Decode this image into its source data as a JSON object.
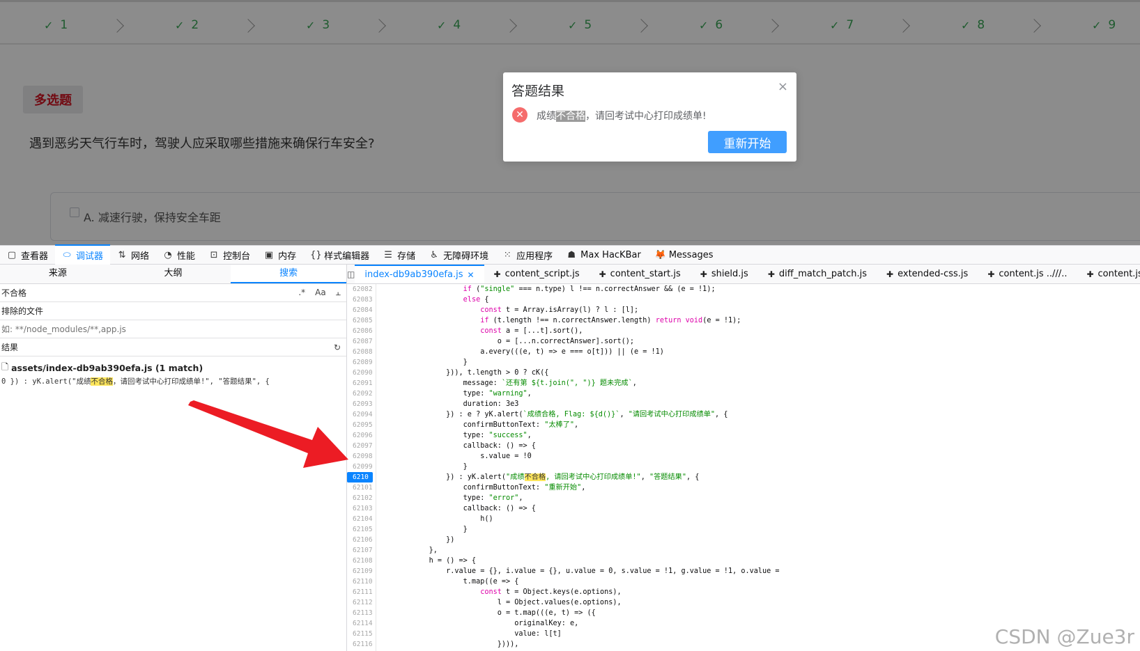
{
  "webpage": {
    "steps": [
      "1",
      "2",
      "3",
      "4",
      "5",
      "6",
      "7",
      "8",
      "9"
    ],
    "question_type": "多选题",
    "question": "遇到恶劣天气行车时，驾驶人应采取哪些措施来确保行车安全?",
    "option_a": "A. 减速行驶，保持安全车距"
  },
  "dialog": {
    "title": "答题结果",
    "close": "×",
    "msg_prefix": "成绩",
    "msg_highlight": "不合格",
    "msg_suffix": "，请回考试中心打印成绩单!",
    "button": "重新开始"
  },
  "devtools": {
    "tabs": [
      {
        "label": "查看器",
        "icon": "inspector-icon"
      },
      {
        "label": "调试器",
        "icon": "debugger-icon"
      },
      {
        "label": "网络",
        "icon": "network-icon"
      },
      {
        "label": "性能",
        "icon": "performance-icon"
      },
      {
        "label": "控制台",
        "icon": "console-icon"
      },
      {
        "label": "内存",
        "icon": "memory-icon"
      },
      {
        "label": "样式编辑器",
        "icon": "style-editor-icon"
      },
      {
        "label": "存储",
        "icon": "storage-icon"
      },
      {
        "label": "无障碍环境",
        "icon": "accessibility-icon"
      },
      {
        "label": "应用程序",
        "icon": "application-icon"
      },
      {
        "label": "Max HacKBar",
        "icon": "hackbar-icon"
      },
      {
        "label": "Messages",
        "icon": "fox-icon"
      }
    ],
    "left_tabs": [
      "来源",
      "大纲",
      "搜索"
    ],
    "search_value": "不合格",
    "search_modifiers": [
      ".*",
      "Aa",
      "ꟷ̲̲"
    ],
    "excluded_label": "排除的文件",
    "excluded_value": "如: **/node_modules/**,app.js",
    "results_label": "结果",
    "result_file": "assets/index-db9ab390efa.js (1 match)",
    "result_prefix": "0 }) : yK.alert(\"成绩",
    "result_highlight": "不合格",
    "result_suffix": "，请回考试中心打印成绩单!\", \"答题结果\", {",
    "editor_tabs": [
      "index-db9ab390efa.js",
      "content_script.js",
      "content_start.js",
      "shield.js",
      "diff_match_patch.js",
      "extended-css.js",
      "content.js ..///..",
      "content.js ..///.."
    ],
    "breakpoint_line": "6210",
    "line_numbers": [
      "62082",
      "62083",
      "62084",
      "62085",
      "62086",
      "62087",
      "62088",
      "62089",
      "62090",
      "62091",
      "62092",
      "62093",
      "62094",
      "62095",
      "62096",
      "62097",
      "62098",
      "62099",
      "6210",
      "62101",
      "62102",
      "62103",
      "62104",
      "62105",
      "62106",
      "62107",
      "62108",
      "62109",
      "62110",
      "62111",
      "62112",
      "62113",
      "62114",
      "62115",
      "62116"
    ],
    "code_lines": [
      "                    if (\"single\" === n.type) l !== n.correctAnswer && (e = !1);",
      "                    else {",
      "                        const t = Array.isArray(l) ? l : [l];",
      "                        if (t.length !== n.correctAnswer.length) return void(e = !1);",
      "                        const a = [...t].sort(),",
      "                            o = [...n.correctAnswer].sort();",
      "                        a.every(((e, t) => e === o[t])) || (e = !1)",
      "                    }",
      "                })), t.length > 0 ? cK({",
      "                    message: `还有第 ${t.join(\", \")} 题未完成`,",
      "                    type: \"warning\",",
      "                    duration: 3e3",
      "                }) : e ? yK.alert(`成绩合格, Flag: ${d()}`, \"请回考试中心打印成绩单\", {",
      "                    confirmButtonText: \"太棒了\",",
      "                    type: \"success\",",
      "                    callback: () => {",
      "                        s.value = !0",
      "                    }",
      "                }) : yK.alert(\"成绩不合格, 请回考试中心打印成绩单!\", \"答题结果\", {",
      "                    confirmButtonText: \"重新开始\",",
      "                    type: \"error\",",
      "                    callback: () => {",
      "                        h()",
      "                    }",
      "                })",
      "            },",
      "            h = () => {",
      "                r.value = {}, i.value = {}, u.value = 0, s.value = !1, g.value = !1, o.value =",
      "                    t.map((e => {",
      "                        const t = Object.keys(e.options),",
      "                            l = Object.values(e.options),",
      "                            o = t.map(((e, t) => ({",
      "                                originalKey: e,",
      "                                value: l[t]",
      "                            }))),"
    ]
  },
  "watermark": "CSDN @Zue3r"
}
